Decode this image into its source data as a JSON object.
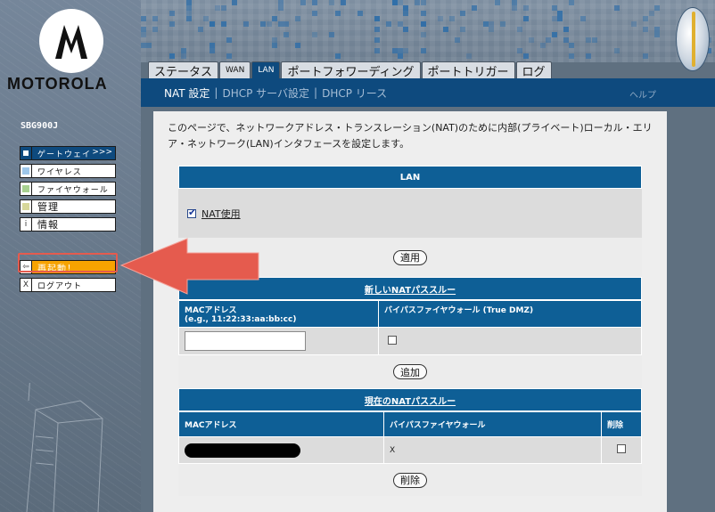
{
  "brand": {
    "name": "MOTOROLA",
    "model": "SBG900J"
  },
  "sidebar": {
    "items": [
      {
        "label": "ゲートウェイ",
        "chevron": ">>>",
        "icon": "white-square-icon",
        "color": "#ffffff",
        "active": true
      },
      {
        "label": "ワイヤレス",
        "icon": "blue-square-icon",
        "color": "#9ec7ea"
      },
      {
        "label": "ファイヤウォール",
        "icon": "green-square-icon",
        "color": "#a8d190"
      },
      {
        "label": "管理",
        "icon": "olive-square-icon",
        "color": "#d7d79a"
      },
      {
        "label": "情報",
        "icon": "info-icon",
        "glyph": "i"
      }
    ],
    "actions": [
      {
        "label": "再起動！",
        "icon": "back-arrow-icon",
        "glyph": "⇦",
        "color": "#f7a300"
      },
      {
        "label": "ログアウト",
        "icon": "close-icon",
        "glyph": "X"
      }
    ]
  },
  "tabs": [
    {
      "label": "ステータス"
    },
    {
      "label": "WAN",
      "small": true
    },
    {
      "label": "LAN",
      "active": true
    },
    {
      "label": "ポートフォワーディング"
    },
    {
      "label": "ポートトリガー"
    },
    {
      "label": "ログ"
    }
  ],
  "subtabs": [
    {
      "label": "NAT 設定",
      "active": true
    },
    {
      "label": "DHCP サーバ設定"
    },
    {
      "label": "DHCP リース"
    }
  ],
  "help_label": "ヘルプ",
  "content": {
    "intro": "このページで、ネットワークアドレス・トランスレーション(NAT)のために内部(プライベート)ローカル・エリア・ネットワーク(LAN)インタフェースを設定します。",
    "lan_section": {
      "title": "LAN",
      "nat_label": "NAT使用",
      "nat_checked": true,
      "apply_button": "適用"
    },
    "new_passthrough": {
      "title": "新しいNATパススルー",
      "col_mac": "MACアドレス",
      "col_mac_hint": "(e.g., 11:22:33:aa:bb:cc)",
      "col_bypass": "バイパスファイヤウォール (True DMZ)",
      "mac_value": "",
      "bypass_checked": false,
      "add_button": "追加"
    },
    "current_passthrough": {
      "title": "現在のNATパススルー",
      "col_mac": "MACアドレス",
      "col_bypass": "バイパスファイヤウォール",
      "col_delete": "削除",
      "rows": [
        {
          "bypass": "X",
          "delete_checked": false
        }
      ],
      "delete_button": "削除"
    }
  },
  "colors": {
    "navy": "#0e4a7e",
    "section_bar": "#0e5f96",
    "reboot": "#f7a300",
    "annotation_arrow": "#e55b4e"
  }
}
